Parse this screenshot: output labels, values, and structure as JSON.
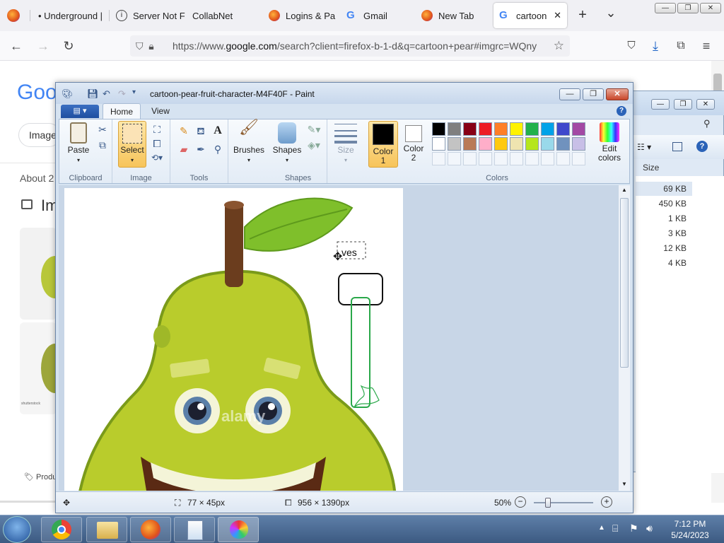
{
  "browser": {
    "tabs": [
      {
        "title": "• Underground |",
        "icon": "firefox-icon"
      },
      {
        "title": "Server Not F",
        "icon": "info-icon"
      },
      {
        "title": "CollabNet",
        "icon": "blank"
      },
      {
        "title": "Logins & Pa",
        "icon": "firefox-icon"
      },
      {
        "title": "Gmail",
        "icon": "google-icon"
      },
      {
        "title": "New Tab",
        "icon": "firefox-icon"
      },
      {
        "title": "cartoon p",
        "icon": "google-icon",
        "active": true
      }
    ],
    "new_tab_label": "+",
    "tab_list_label": "⌄",
    "url_prefix": "https://www.",
    "url_domain": "google.com",
    "url_rest": "/search?client=firefox-b-1-d&q=cartoon+pear#imgrc=WQny",
    "window_buttons": {
      "min": "—",
      "max": "❐",
      "close": "✕"
    }
  },
  "google": {
    "logo": "Goo",
    "chip": "Image",
    "about": "About 2",
    "images_heading": "Im",
    "product_label": "Produ",
    "thumb_caption": "shutterstock"
  },
  "explorer": {
    "column_header": "Size",
    "sizes": [
      "69 KB",
      "450 KB",
      "1 KB",
      "3 KB",
      "12 KB",
      "4 KB"
    ]
  },
  "paint": {
    "title": "cartoon-pear-fruit-character-M4F40F - Paint",
    "file_menu": "▤ ▾",
    "tabs": {
      "home": "Home",
      "view": "View"
    },
    "ribbon": {
      "paste": "Paste",
      "select": "Select",
      "brushes": "Brushes",
      "shapes": "Shapes",
      "size": "Size",
      "color1": "Color\n1",
      "color1_a": "Color",
      "color1_b": "1",
      "color2_a": "Color",
      "color2_b": "2",
      "edit_colors_a": "Edit",
      "edit_colors_b": "colors",
      "groups": {
        "clipboard": "Clipboard",
        "image": "Image",
        "tools": "Tools",
        "shapes": "Shapes",
        "colors": "Colors"
      }
    },
    "palette": [
      "#000000",
      "#7f7f7f",
      "#880015",
      "#ed1c24",
      "#ff7f27",
      "#fff200",
      "#22b14c",
      "#00a2e8",
      "#3f48cc",
      "#a349a4",
      "#ffffff",
      "#c3c3c3",
      "#b97a57",
      "#ffaec9",
      "#ffc90e",
      "#efe4b0",
      "#b5e61d",
      "#99d9ea",
      "#7092be",
      "#c8bfe7"
    ],
    "color1": "#000000",
    "color2": "#ffffff",
    "canvas_text": "ves",
    "watermark": "alamy",
    "status": {
      "selection_size": "77 × 45px",
      "image_size": "956 × 1390px",
      "zoom": "50%"
    }
  },
  "taskbar": {
    "time": "7:12 PM",
    "date": "5/24/2023"
  }
}
